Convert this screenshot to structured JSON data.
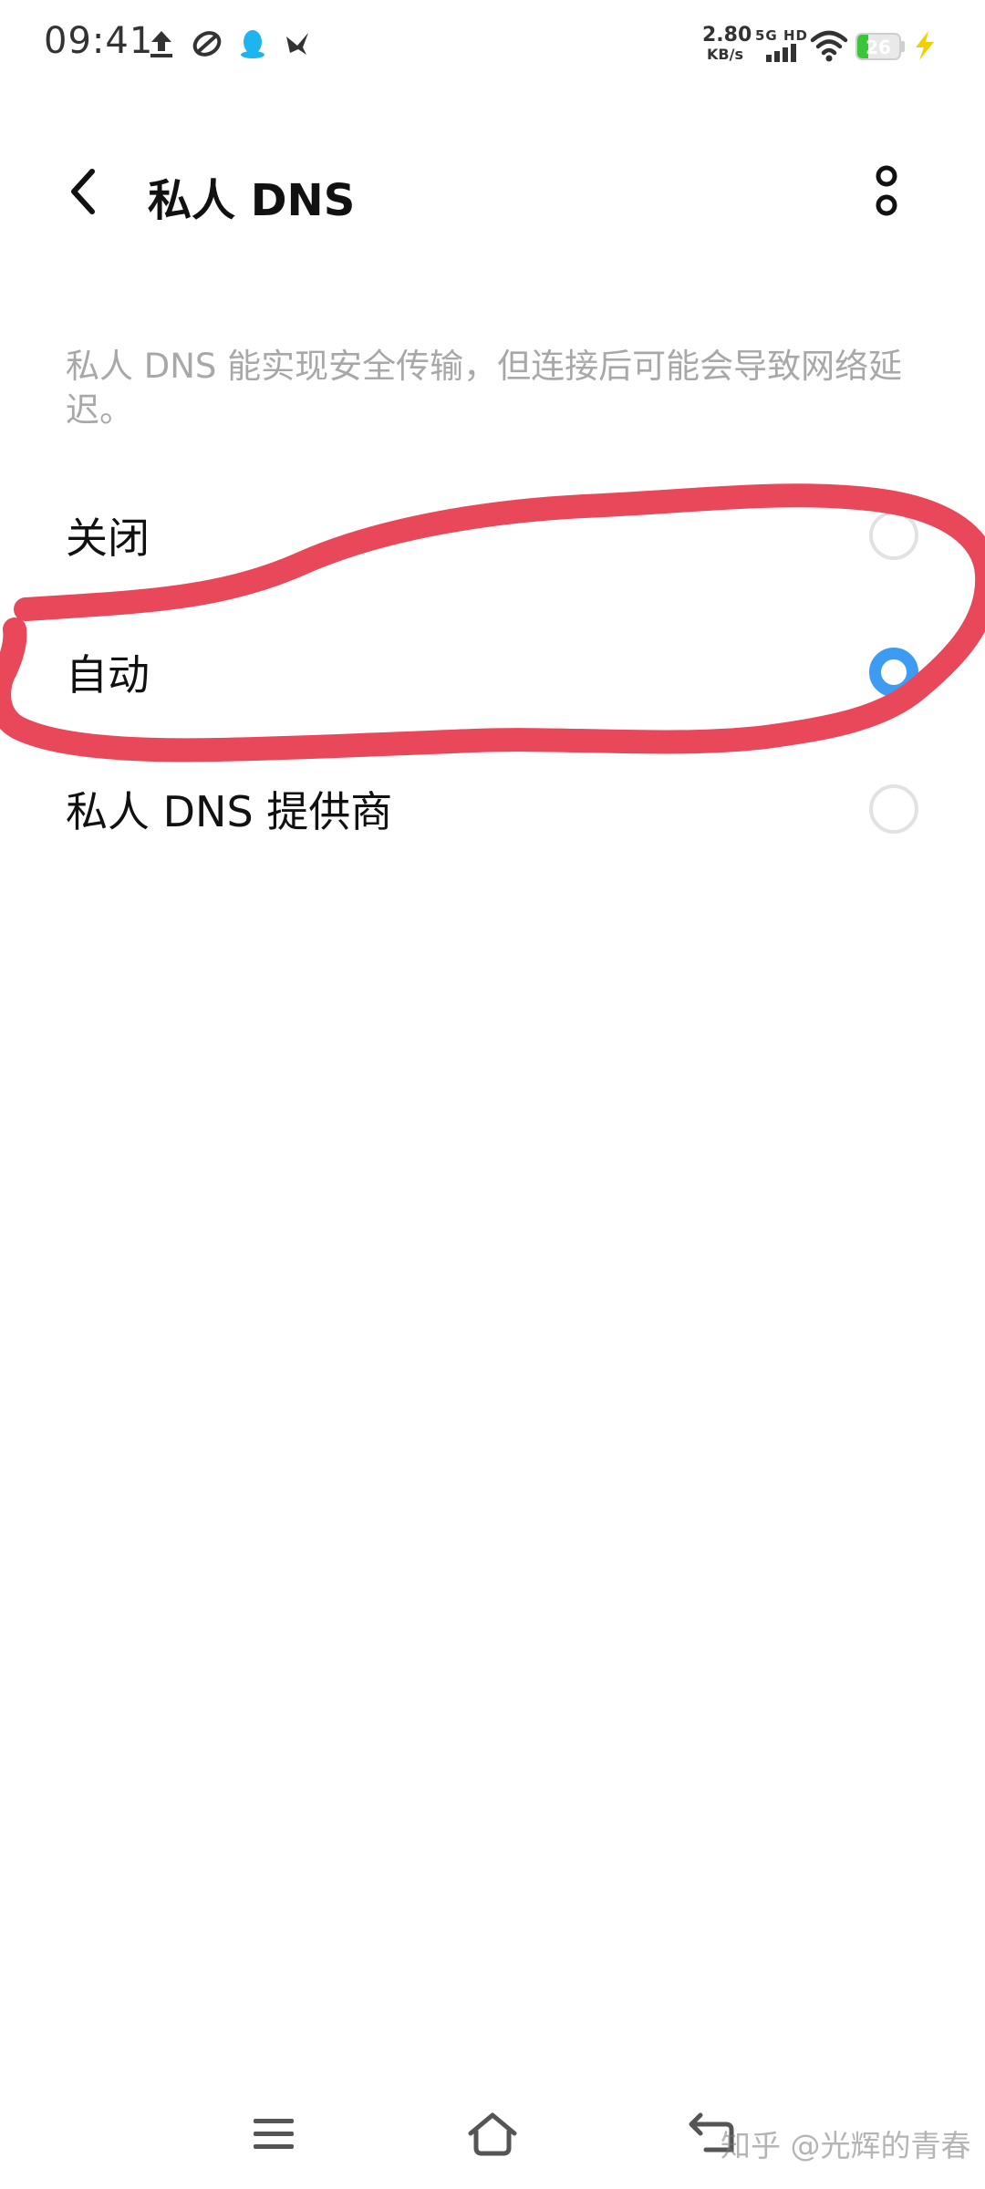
{
  "status_bar": {
    "time": "09:41",
    "left_icons": [
      "upload-icon",
      "app-leaf-icon",
      "qq-penguin-icon",
      "bird-icon"
    ],
    "net_speed_value": "2.80",
    "net_speed_unit": "KB/s",
    "network_type": "5G HD",
    "battery_level": "26",
    "battery_fraction": 0.26,
    "charging": true
  },
  "header": {
    "title": "私人 DNS",
    "back_icon": "chevron-left-icon",
    "more_icon": "more-vertical-icon"
  },
  "description": "私人 DNS 能实现安全传输，但连接后可能会导致网络延迟。",
  "options": [
    {
      "label": "关闭",
      "selected": false
    },
    {
      "label": "自动",
      "selected": true
    },
    {
      "label": "私人 DNS 提供商",
      "selected": false
    }
  ],
  "colors": {
    "accent": "#3d9bf2",
    "annotation": "#e8485a",
    "secondary_text": "#a8a8a8",
    "battery": "#39c739"
  },
  "nav_bar": {
    "icons": [
      "menu-icon",
      "home-icon",
      "back-icon"
    ]
  },
  "watermark": "知乎 @光辉的青春"
}
